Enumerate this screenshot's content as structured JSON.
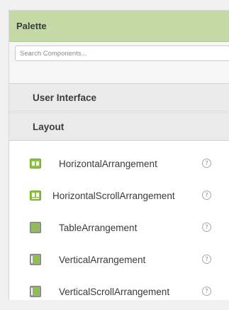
{
  "palette": {
    "title": "Palette",
    "search": {
      "placeholder": "Search Components...",
      "value": ""
    }
  },
  "categories": {
    "user_interface": "User Interface",
    "layout": "Layout"
  },
  "layout_items": [
    {
      "label": "HorizontalArrangement",
      "icon": "horizontal-arrangement-icon",
      "help": "?"
    },
    {
      "label": "HorizontalScrollArrangement",
      "icon": "horizontal-scroll-arrangement-icon",
      "help": "?"
    },
    {
      "label": "TableArrangement",
      "icon": "table-arrangement-icon",
      "help": "?"
    },
    {
      "label": "VerticalArrangement",
      "icon": "vertical-arrangement-icon",
      "help": "?"
    },
    {
      "label": "VerticalScrollArrangement",
      "icon": "vertical-scroll-arrangement-icon",
      "help": "?"
    }
  ],
  "colors": {
    "header_bg": "#c5d9a6",
    "icon_green": "#8cc63f",
    "icon_gray": "#9e9e9e"
  }
}
